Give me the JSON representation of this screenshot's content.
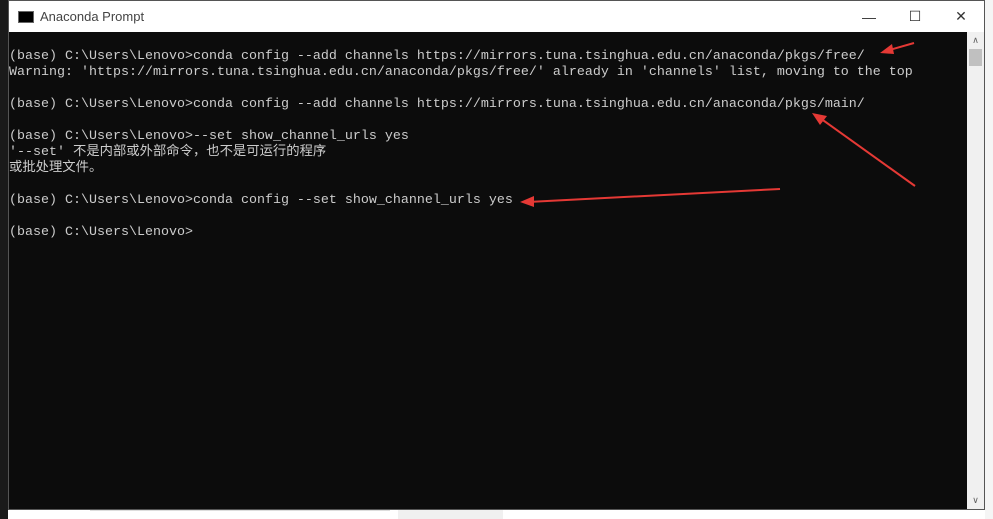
{
  "window": {
    "title": "Anaconda Prompt",
    "minimize": "—",
    "maximize": "☐",
    "close": "✕"
  },
  "terminal": {
    "lines": [
      "(base) C:\\Users\\Lenovo>conda config --add channels https://mirrors.tuna.tsinghua.edu.cn/anaconda/pkgs/free/",
      "Warning: 'https://mirrors.tuna.tsinghua.edu.cn/anaconda/pkgs/free/' already in 'channels' list, moving to the top",
      "",
      "(base) C:\\Users\\Lenovo>conda config --add channels https://mirrors.tuna.tsinghua.edu.cn/anaconda/pkgs/main/",
      "",
      "(base) C:\\Users\\Lenovo>--set show_channel_urls yes",
      "'--set' 不是内部或外部命令，也不是可运行的程序",
      "或批处理文件。",
      "",
      "(base) C:\\Users\\Lenovo>conda config --set show_channel_urls yes",
      "",
      "(base) C:\\Users\\Lenovo>"
    ]
  },
  "scrollbar": {
    "up": "∧",
    "down": "∨"
  },
  "colors": {
    "terminal_bg": "#0c0c0c",
    "terminal_fg": "#cccccc",
    "annotation_arrow": "#e53935"
  }
}
